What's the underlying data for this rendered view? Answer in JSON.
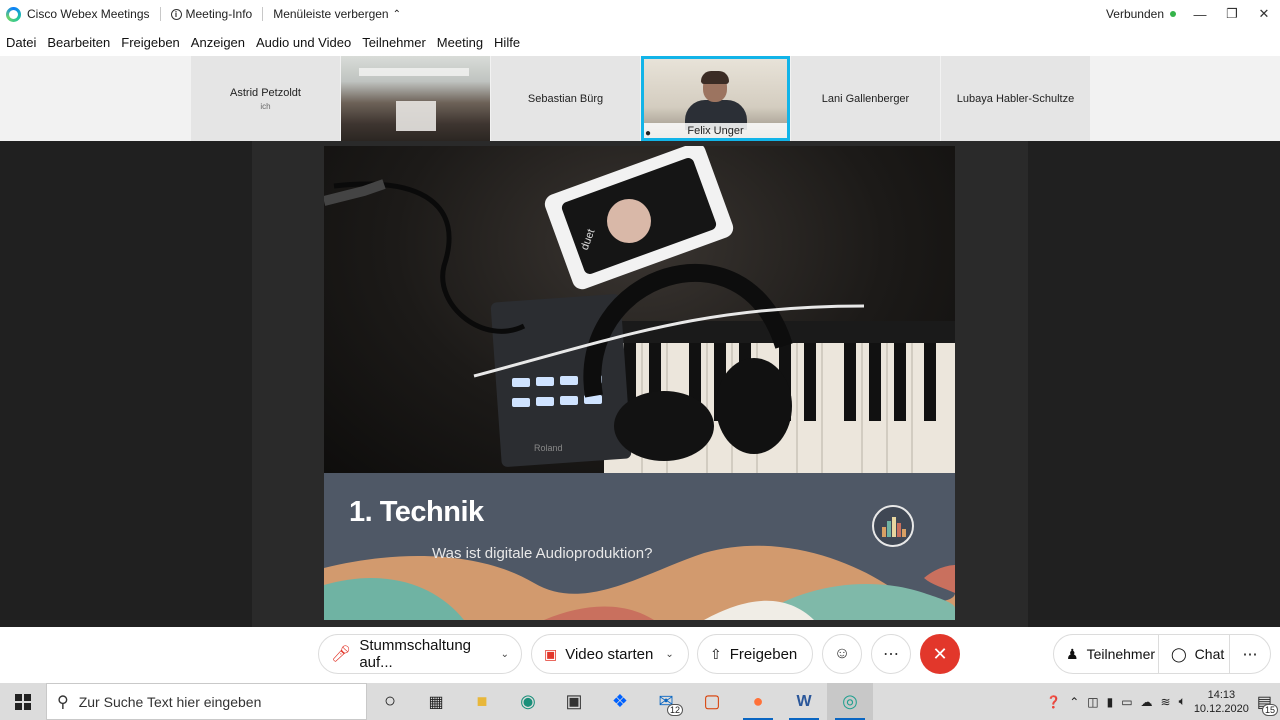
{
  "titlebar": {
    "app_title": "Cisco Webex Meetings",
    "meeting_info": "Meeting-Info",
    "hide_menu": "Menüleiste verbergen",
    "status": "Verbunden",
    "status_color": "#35b34a"
  },
  "menu": [
    "Datei",
    "Bearbeiten",
    "Freigeben",
    "Anzeigen",
    "Audio und Video",
    "Teilnehmer",
    "Meeting",
    "Hilfe"
  ],
  "participants": {
    "p1_name": "Astrid Petzoldt",
    "p1_sub": "ich",
    "p3_name": "Sebastian Bürg",
    "p4_name": "Felix Unger",
    "p5_name": "Lani Gallenberger",
    "p6_name": "Lubaya Habler-Schultze",
    "active_speaker_color": "#12b4e8"
  },
  "slide": {
    "title": "1. Technik",
    "subtitle": "Was ist digitale Audioproduktion?",
    "device_label_1": "duet",
    "device_label_2": "Roland"
  },
  "controls": {
    "mute_label": "Stummschaltung auf...",
    "video_label": "Video starten",
    "share_label": "Freigeben",
    "participants_label": "Teilnehmer",
    "chat_label": "Chat",
    "end_color": "#e2372b"
  },
  "taskbar": {
    "search_placeholder": "Zur Suche Text hier eingeben",
    "mail_badge": "12",
    "time": "14:13",
    "date": "10.12.2020",
    "notification_count": "15"
  }
}
